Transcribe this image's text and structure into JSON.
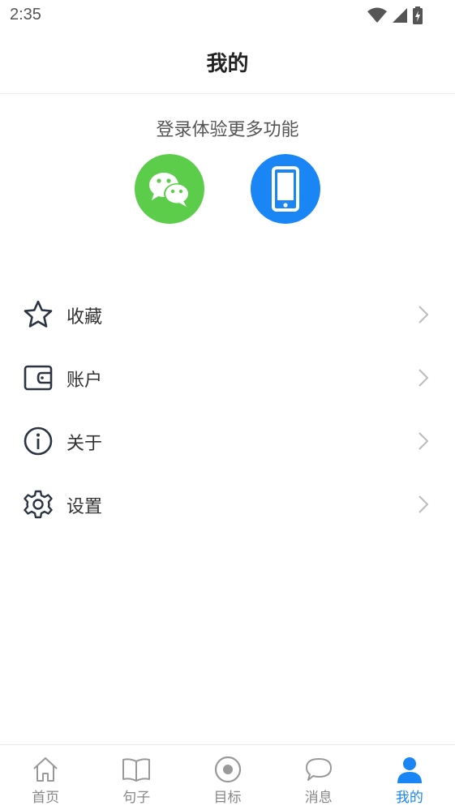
{
  "status_bar": {
    "time": "2:35",
    "icons": [
      "wifi-icon",
      "cell-signal-icon",
      "battery-charging-icon"
    ]
  },
  "header": {
    "title": "我的"
  },
  "login": {
    "hint": "登录体验更多功能",
    "methods": [
      {
        "name": "wechat",
        "icon": "wechat-icon",
        "color": "#5ccd4a"
      },
      {
        "name": "phone",
        "icon": "smartphone-icon",
        "color": "#1a86f5"
      }
    ]
  },
  "menu": {
    "items": [
      {
        "label": "收藏",
        "icon": "star-icon"
      },
      {
        "label": "账户",
        "icon": "wallet-icon"
      },
      {
        "label": "关于",
        "icon": "info-icon"
      },
      {
        "label": "设置",
        "icon": "gear-icon"
      }
    ]
  },
  "tab_bar": {
    "items": [
      {
        "label": "首页",
        "icon": "home-icon",
        "active": false
      },
      {
        "label": "句子",
        "icon": "book-icon",
        "active": false
      },
      {
        "label": "目标",
        "icon": "target-icon",
        "active": false
      },
      {
        "label": "消息",
        "icon": "chat-bubble-icon",
        "active": false
      },
      {
        "label": "我的",
        "icon": "user-icon",
        "active": true
      }
    ],
    "active_color": "#1a86f5",
    "inactive_color": "#888888"
  }
}
